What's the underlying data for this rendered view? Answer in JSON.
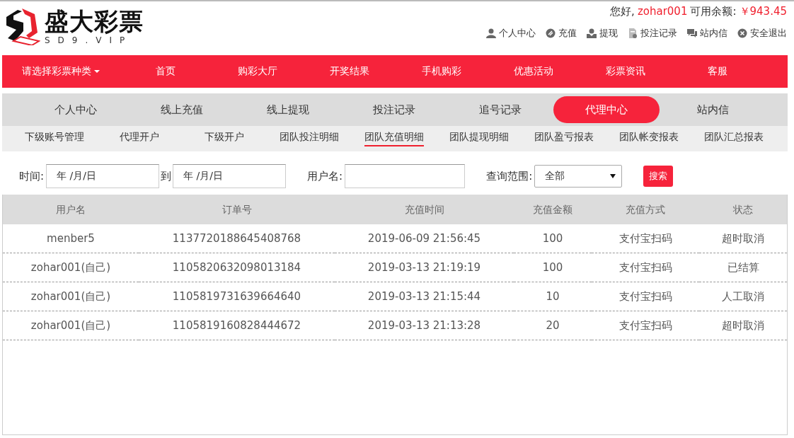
{
  "header": {
    "logo": {
      "title": "盛大彩票",
      "subtitle": "SD9.VIP"
    },
    "greeting": {
      "prefix": "您好,",
      "username": "zohar001",
      "balance_label": "可用余额:",
      "balance": "￥943.45"
    },
    "user_links": [
      {
        "label": "个人中心",
        "kind": "user"
      },
      {
        "label": "充值",
        "kind": "recharge"
      },
      {
        "label": "提现",
        "kind": "withdraw"
      },
      {
        "label": "投注记录",
        "kind": "records"
      },
      {
        "label": "站内信",
        "kind": "messages"
      },
      {
        "label": "安全退出",
        "kind": "logout"
      }
    ]
  },
  "nav": {
    "category_menu": "请选择彩票种类",
    "items": [
      "首页",
      "购彩大厅",
      "开奖结果",
      "手机购彩",
      "优惠活动",
      "彩票资讯",
      "客服"
    ]
  },
  "tabs": [
    {
      "label": "个人中心",
      "selected": false
    },
    {
      "label": "线上充值",
      "selected": false
    },
    {
      "label": "线上提现",
      "selected": false
    },
    {
      "label": "投注记录",
      "selected": false
    },
    {
      "label": "追号记录",
      "selected": false
    },
    {
      "label": "代理中心",
      "selected": true
    },
    {
      "label": "站内信",
      "selected": false
    }
  ],
  "subtabs": [
    {
      "label": "下级账号管理",
      "selected": false
    },
    {
      "label": "代理开户",
      "selected": false
    },
    {
      "label": "下级开户",
      "selected": false
    },
    {
      "label": "团队投注明细",
      "selected": false
    },
    {
      "label": "团队充值明细",
      "selected": true
    },
    {
      "label": "团队提现明细",
      "selected": false
    },
    {
      "label": "团队盈亏报表",
      "selected": false
    },
    {
      "label": "团队帐变报表",
      "selected": false
    },
    {
      "label": "团队汇总报表",
      "selected": false
    }
  ],
  "filters": {
    "time_label": "时间:",
    "date_from": "年 /月/日",
    "to_label": "到",
    "date_to": "年 /月/日",
    "username_label": "用户名:",
    "scope_label": "查询范围:",
    "scope_value": "全部",
    "search_button": "搜索"
  },
  "table": {
    "columns": [
      "用户名",
      "订单号",
      "充值时间",
      "充值金额",
      "充值方式",
      "状态"
    ],
    "rows": [
      [
        "menber5",
        "1137720188645408768",
        "2019-06-09 21:56:45",
        "100",
        "支付宝扫码",
        "超时取消"
      ],
      [
        "zohar001(自己)",
        "1105820632098013184",
        "2019-03-13 21:19:19",
        "100",
        "支付宝扫码",
        "已结算"
      ],
      [
        "zohar001(自己)",
        "1105819731639664640",
        "2019-03-13 21:15:44",
        "10",
        "支付宝扫码",
        "人工取消"
      ],
      [
        "zohar001(自己)",
        "1105819160828444672",
        "2019-03-13 21:13:28",
        "20",
        "支付宝扫码",
        "超时取消"
      ]
    ]
  }
}
